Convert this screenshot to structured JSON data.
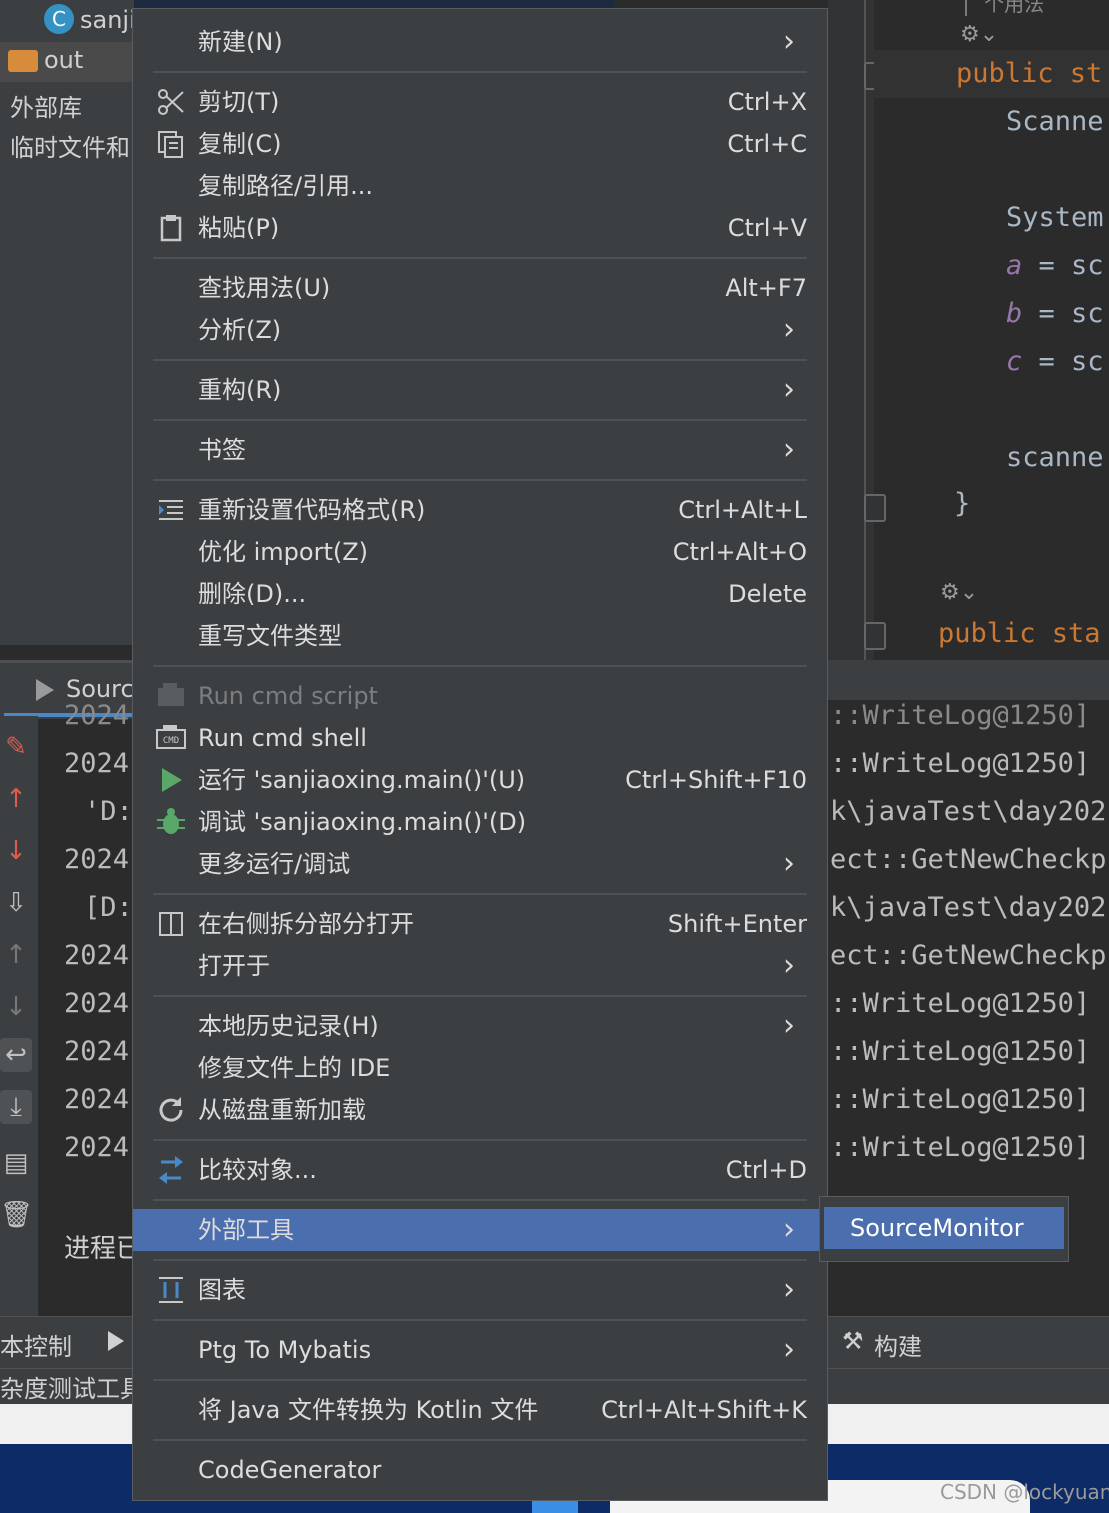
{
  "project": {
    "top_item": "sanji",
    "items": [
      "out",
      "外部库",
      "临时文件和"
    ]
  },
  "editor": {
    "lines": [
      {
        "text": "| 个用法",
        "cls": ""
      },
      {
        "text": "public st",
        "cls": "kw"
      },
      {
        "text": "Scanne",
        "cls": ""
      },
      {
        "text": "System",
        "cls": ""
      },
      {
        "text": "a",
        "cls": "var",
        "rest": " = sc"
      },
      {
        "text": "b",
        "cls": "var",
        "rest": " = sc"
      },
      {
        "text": "c",
        "cls": "var",
        "rest": " = sc"
      },
      {
        "text": "scanne",
        "cls": ""
      },
      {
        "text": "}",
        "cls": ""
      },
      {
        "text": "public sta",
        "cls": "kw"
      }
    ]
  },
  "run_panel": {
    "tab_label": "Sourc",
    "left_lines": [
      "2024",
      "2024",
      "'D:",
      "2024",
      "[D:",
      "2024",
      "2024",
      "2024",
      "2024",
      "2024"
    ],
    "right_lines": [
      "::WriteLog@1250]",
      "::WriteLog@1250]",
      "k\\javaTest\\day202",
      "ect::GetNewCheckp",
      "k\\javaTest\\day202",
      "ect::GetNewCheckp",
      "::WriteLog@1250]",
      "::WriteLog@1250]",
      "::WriteLog@1250]",
      "::WriteLog@1250]"
    ],
    "process_text": "进程已"
  },
  "bottom_bar": {
    "vcs_label": "本控制",
    "build_label": "构建"
  },
  "status_bar": {
    "text": "杂度测试工具"
  },
  "menu": {
    "items": [
      {
        "label": "新建(N)",
        "shortcut": "",
        "submenu": true,
        "icon": ""
      },
      {
        "label": "剪切(T)",
        "shortcut": "Ctrl+X",
        "submenu": false,
        "icon": "scissors-icon"
      },
      {
        "label": "复制(C)",
        "shortcut": "Ctrl+C",
        "submenu": false,
        "icon": "copy-icon"
      },
      {
        "label": "复制路径/引用...",
        "shortcut": "",
        "submenu": false,
        "icon": ""
      },
      {
        "label": "粘贴(P)",
        "shortcut": "Ctrl+V",
        "submenu": false,
        "icon": "paste-icon"
      },
      {
        "label": "查找用法(U)",
        "shortcut": "Alt+F7",
        "submenu": false,
        "icon": ""
      },
      {
        "label": "分析(Z)",
        "shortcut": "",
        "submenu": true,
        "icon": ""
      },
      {
        "label": "重构(R)",
        "shortcut": "",
        "submenu": true,
        "icon": ""
      },
      {
        "label": "书签",
        "shortcut": "",
        "submenu": true,
        "icon": ""
      },
      {
        "label": "重新设置代码格式(R)",
        "shortcut": "Ctrl+Alt+L",
        "submenu": false,
        "icon": "reformat-icon"
      },
      {
        "label": "优化 import(Z)",
        "shortcut": "Ctrl+Alt+O",
        "submenu": false,
        "icon": ""
      },
      {
        "label": "删除(D)...",
        "shortcut": "Delete",
        "submenu": false,
        "icon": ""
      },
      {
        "label": "重写文件类型",
        "shortcut": "",
        "submenu": false,
        "icon": ""
      },
      {
        "label": "Run cmd script",
        "shortcut": "",
        "submenu": false,
        "icon": "cmd-script-icon",
        "disabled": true
      },
      {
        "label": "Run cmd shell",
        "shortcut": "",
        "submenu": false,
        "icon": "cmd-shell-icon"
      },
      {
        "label": "运行 'sanjiaoxing.main()'(U)",
        "shortcut": "Ctrl+Shift+F10",
        "submenu": false,
        "icon": "run-icon"
      },
      {
        "label": "调试 'sanjiaoxing.main()'(D)",
        "shortcut": "",
        "submenu": false,
        "icon": "debug-bug-icon"
      },
      {
        "label": "更多运行/调试",
        "shortcut": "",
        "submenu": true,
        "icon": ""
      },
      {
        "label": "在右侧拆分部分打开",
        "shortcut": "Shift+Enter",
        "submenu": false,
        "icon": "split-right-icon"
      },
      {
        "label": "打开于",
        "shortcut": "",
        "submenu": true,
        "icon": ""
      },
      {
        "label": "本地历史记录(H)",
        "shortcut": "",
        "submenu": true,
        "icon": ""
      },
      {
        "label": "修复文件上的 IDE",
        "shortcut": "",
        "submenu": false,
        "icon": ""
      },
      {
        "label": "从磁盘重新加载",
        "shortcut": "",
        "submenu": false,
        "icon": "reload-icon"
      },
      {
        "label": "比较对象...",
        "shortcut": "Ctrl+D",
        "submenu": false,
        "icon": "compare-icon"
      },
      {
        "label": "外部工具",
        "shortcut": "",
        "submenu": true,
        "icon": "",
        "selected": true
      },
      {
        "label": "图表",
        "shortcut": "",
        "submenu": true,
        "icon": "diagram-icon"
      },
      {
        "label": "Ptg To Mybatis",
        "shortcut": "",
        "submenu": true,
        "icon": ""
      },
      {
        "label": "将 Java 文件转换为 Kotlin 文件",
        "shortcut": "Ctrl+Alt+Shift+K",
        "submenu": false,
        "icon": ""
      },
      {
        "label": "CodeGenerator",
        "shortcut": "",
        "submenu": false,
        "icon": ""
      }
    ],
    "arrow_glyph": "›"
  },
  "submenu": {
    "items": [
      "SourceMonitor"
    ]
  },
  "watermark": "CSDN @lockyuan",
  "colors": {
    "menu_bg": "#3c3f41",
    "selection": "#4b6eaf",
    "keyword": "#cc7832",
    "variable": "#9876aa"
  }
}
